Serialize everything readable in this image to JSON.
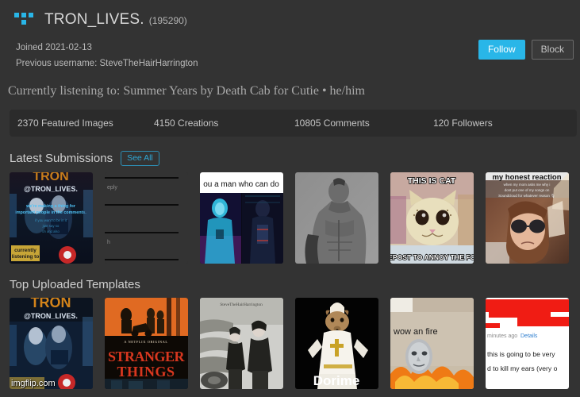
{
  "profile": {
    "logo_icon": "four-dots-icon",
    "username": "TRON_LIVES.",
    "points": "(195290)",
    "joined": "Joined 2021-02-13",
    "previous_username": "Previous username: SteveTheHairHarrington",
    "status": "Currently listening to: Summer Years by Death Cab for Cutie • he/him",
    "follow_label": "Follow",
    "block_label": "Block",
    "accent_color": "#29b6e8"
  },
  "stats": [
    "2370 Featured Images",
    "4150 Creations",
    "10805 Comments",
    "120 Followers"
  ],
  "sections": [
    {
      "title": "Latest Submissions",
      "see_all_label": "See All",
      "thumbs": [
        {
          "name": "tron-lives-announcement",
          "top_text": "@TRON_LIVES.",
          "body_text": "we're making a thing for important people in the comments",
          "corner_text": "currently listening to"
        },
        {
          "name": "blank-comment-reply",
          "top_text": "eply",
          "body_text": "h",
          "corner_text": ""
        },
        {
          "name": "a-man-who-can-do",
          "top_text": "ou a man who can do",
          "body_text": "",
          "corner_text": ""
        },
        {
          "name": "bodybuilder-photo",
          "top_text": "",
          "body_text": "",
          "corner_text": ""
        },
        {
          "name": "this-is-cat",
          "top_text": "THIS IS CAT",
          "body_text": "",
          "corner_text": "REPOST TO ANNOY THE FOX"
        },
        {
          "name": "my-honest-reaction",
          "top_text": "my honest reaction",
          "body_text": "when my mom asks me why i dont put one of my songs on Soundcloud for whatever reason",
          "corner_text": ""
        }
      ]
    },
    {
      "title": "Top Uploaded Templates",
      "see_all_label": "",
      "thumbs": [
        {
          "name": "tron-lives-announcement-2",
          "top_text": "@TRON_LIVES.",
          "body_text": "",
          "corner_text": ""
        },
        {
          "name": "stranger-things-poster",
          "top_text": "A NETFLIX ORIGINAL",
          "body_text": "STRANGER THINGS",
          "corner_text": ""
        },
        {
          "name": "steve-the-hair-harrington-photo",
          "top_text": "SteveTheHairHarrington",
          "body_text": "",
          "corner_text": ""
        },
        {
          "name": "dorime-rat",
          "top_text": "",
          "body_text": "Dorime",
          "corner_text": ""
        },
        {
          "name": "wow-an-fire",
          "top_text": "wow an fire",
          "body_text": "",
          "corner_text": ""
        },
        {
          "name": "redacted-chat-screenshot",
          "top_text": "minutes ago  Details",
          "body_text": "this is going to be very",
          "corner_text": "d to kill my ears (very o"
        }
      ]
    }
  ],
  "watermark": "imgflip.com"
}
